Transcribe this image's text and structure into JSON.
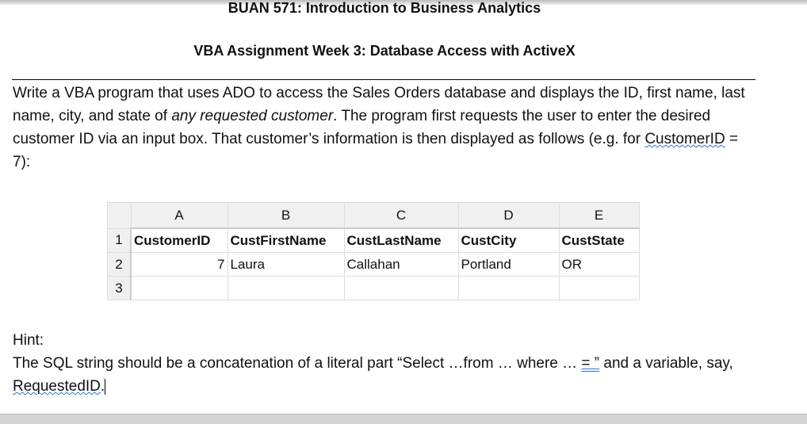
{
  "title": "BUAN 571: Introduction to Business Analytics",
  "subtitle": "VBA Assignment Week 3: Database Access with ActiveX",
  "para": {
    "p1": "Write a VBA program that uses ADO to access the Sales Orders database and displays the ID, first name, last name, city, and state of ",
    "em": "any requested customer",
    "p2": ". The program first requests the user to enter the desired customer ID via an input box.  That customer’s information is then displayed as follows (e.g. for ",
    "cid": "CustomerID",
    "p3": " = 7):"
  },
  "sheet": {
    "columns": [
      "A",
      "B",
      "C",
      "D",
      "E"
    ],
    "rows": [
      "1",
      "2",
      "3"
    ],
    "header": [
      "CustomerID",
      "CustFirstName",
      "CustLastName",
      "CustCity",
      "CustState"
    ],
    "record": [
      "7",
      "Laura",
      "Callahan",
      "Portland",
      "OR"
    ]
  },
  "hint": {
    "label": "Hint:",
    "p1": "The SQL string should be a concatenation of a literal part “Select …from … where … ",
    "eq": "= ”",
    "p2": " and a variable, say, ",
    "var": "RequestedID",
    "p3": "."
  }
}
